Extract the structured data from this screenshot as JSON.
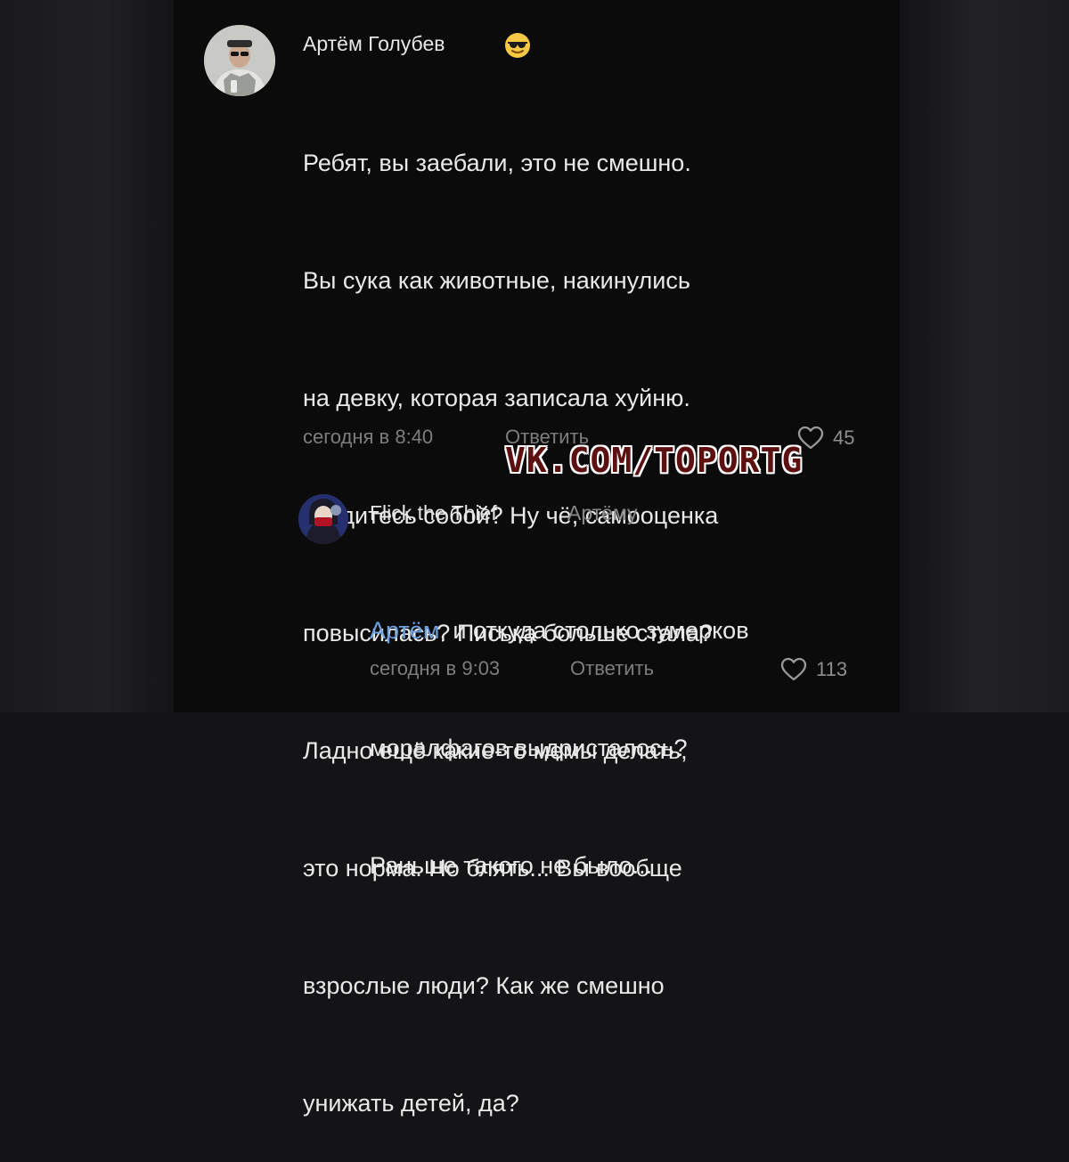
{
  "comment": {
    "author": "Артём Голубев",
    "author_emoji": "cool-sunglasses-emoji",
    "lines": [
      "Ребят, вы заебали, это не смешно.",
      "Вы сука как животные, накинулись",
      "на девку, которая записала хуйню.",
      "Гордитесь собой? Ну чё, самооценка",
      "повысилась? Писька больше стала?",
      "Ладно ещё какие-то мемы делать,",
      "это норма. Но блять... Вы вообще",
      "взрослые люди? Как же смешно",
      "унижать детей, да?"
    ],
    "time": "сегодня в 8:40",
    "reply_label": "Ответить",
    "likes": "45"
  },
  "reply": {
    "author": "Flick the Thief",
    "reply_to": "Артёму",
    "mention": "Артём",
    "first_line_rest": ", и откуда столько зумерков",
    "lines": [
      "моралфагов выдристалось?",
      "Раньше такого не было..."
    ],
    "time": "сегодня в 9:03",
    "reply_label": "Ответить",
    "likes": "113"
  },
  "watermark": "VK.COM/TOPORTG",
  "colors": {
    "background": "#0b0b0c",
    "text": "#e9e9e9",
    "meta": "#7d7d7d",
    "mention": "#6ea2e0",
    "watermark": "#5c1010"
  }
}
